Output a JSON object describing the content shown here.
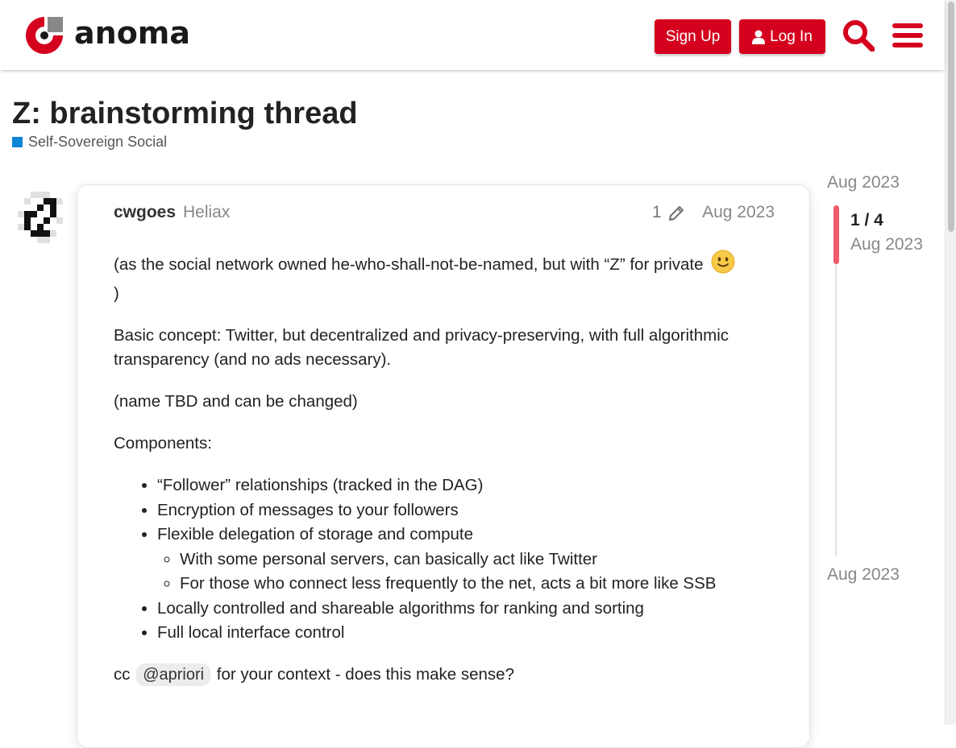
{
  "header": {
    "logo_text": "anoma",
    "signup_label": "Sign Up",
    "login_label": "Log In"
  },
  "topic": {
    "title": "Z: brainstorming thread",
    "category": "Self-Sovereign Social",
    "category_color": "#0d86d8"
  },
  "post": {
    "username": "cwgoes",
    "user_title": "Heliax",
    "edit_count": "1",
    "date": "Aug 2023",
    "p1": "(as the social network owned he-who-shall-not-be-named, but with “Z” for private",
    "p1_end": ")",
    "p2": "Basic concept: Twitter, but decentralized and privacy-preserving, with full algorithmic transparency (and no ads necessary).",
    "p3": "(name TBD and can be changed)",
    "p4": "Components:",
    "list": [
      "“Follower” relationships (tracked in the DAG)",
      "Encryption of messages to your followers",
      "Flexible delegation of storage and compute",
      "Locally controlled and shareable algorithms for ranking and sorting",
      "Full local interface control"
    ],
    "sublist": [
      "With some personal servers, can basically act like Twitter",
      "For those who connect less frequently to the net, acts a bit more like SSB"
    ],
    "cc_prefix": "cc",
    "mention": "@apriori",
    "cc_suffix": "for your context - does this make sense?"
  },
  "timeline": {
    "top_date": "Aug 2023",
    "count": "1 / 4",
    "current_date": "Aug 2023",
    "bottom_date": "Aug 2023"
  },
  "colors": {
    "brand_red": "#d4001e",
    "timeline_handle": "#f05a6a"
  }
}
